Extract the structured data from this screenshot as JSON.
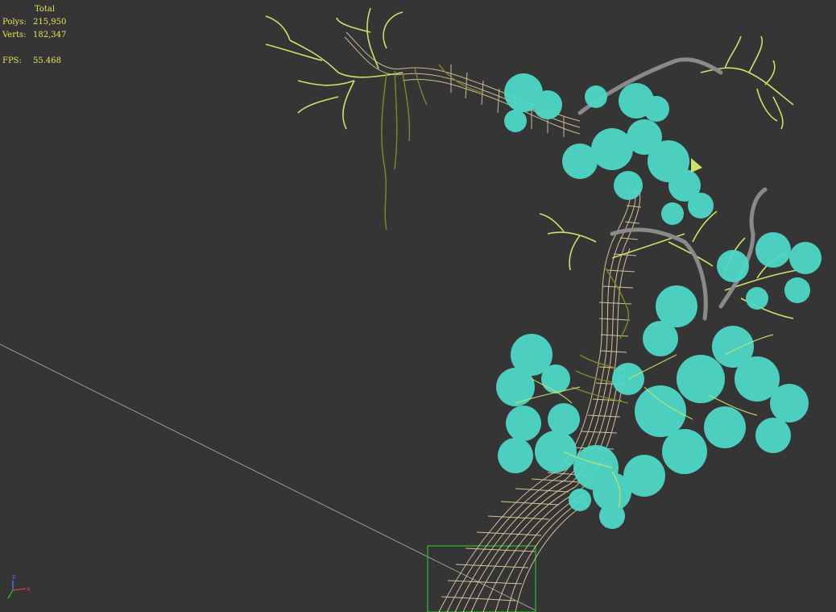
{
  "stats": {
    "header": "Total",
    "polys_label": "Polys:",
    "polys_value": "215,950",
    "verts_label": "Verts:",
    "verts_value": "182,347",
    "fps_label": "FPS:",
    "fps_value": "55.468"
  },
  "gizmo": {
    "z_label": "z",
    "x_label": "x"
  },
  "colors": {
    "background": "#353535",
    "stats_text": "#e8e45a",
    "trunk": "#e6d3a6",
    "branch": "#c9e36a",
    "vine": "#7d8a2a",
    "foliage": "#4fd8c8",
    "dead_branch": "#8a8a8a",
    "selection_box": "#2fd12f",
    "grid_line": "#9a9a9a"
  }
}
